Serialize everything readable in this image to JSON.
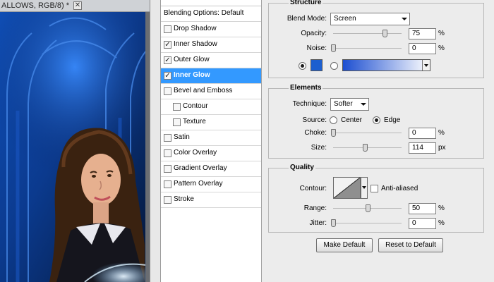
{
  "document_tab": {
    "title": "ALLOWS, RGB/8) *",
    "close_symbol": "✕"
  },
  "style_list": {
    "items": [
      {
        "label": "Blending Options: Default",
        "type": "header"
      },
      {
        "label": "Drop Shadow",
        "checked": false
      },
      {
        "label": "Inner Shadow",
        "checked": true
      },
      {
        "label": "Outer Glow",
        "checked": true
      },
      {
        "label": "Inner Glow",
        "checked": true,
        "selected": true
      },
      {
        "label": "Bevel and Emboss",
        "checked": false
      },
      {
        "label": "Contour",
        "checked": false,
        "indent": true
      },
      {
        "label": "Texture",
        "checked": false,
        "indent": true
      },
      {
        "label": "Satin",
        "checked": false
      },
      {
        "label": "Color Overlay",
        "checked": false
      },
      {
        "label": "Gradient Overlay",
        "checked": false
      },
      {
        "label": "Pattern Overlay",
        "checked": false
      },
      {
        "label": "Stroke",
        "checked": false
      }
    ]
  },
  "structure": {
    "title": "Structure",
    "blend_mode_label": "Blend Mode:",
    "blend_mode_value": "Screen",
    "opacity_label": "Opacity:",
    "opacity_value": "75",
    "opacity_level": 0.75,
    "noise_label": "Noise:",
    "noise_value": "0",
    "noise_level": 0,
    "percent": "%",
    "color_swatch": "#1c5fcf",
    "gradient_colors": [
      "#1d4fd1",
      "#ffffff"
    ]
  },
  "elements": {
    "title": "Elements",
    "technique_label": "Technique:",
    "technique_value": "Softer",
    "source_label": "Source:",
    "source_center": "Center",
    "source_edge": "Edge",
    "choke_label": "Choke:",
    "choke_value": "0",
    "choke_level": 0,
    "size_label": "Size:",
    "size_value": "114",
    "size_level": 0.46,
    "percent": "%",
    "px": "px"
  },
  "quality": {
    "title": "Quality",
    "contour_label": "Contour:",
    "anti_aliased_label": "Anti-aliased",
    "range_label": "Range:",
    "range_value": "50",
    "range_level": 0.5,
    "jitter_label": "Jitter:",
    "jitter_value": "0",
    "jitter_level": 0,
    "percent": "%"
  },
  "buttons": {
    "make_default": "Make Default",
    "reset_to_default": "Reset to Default"
  }
}
